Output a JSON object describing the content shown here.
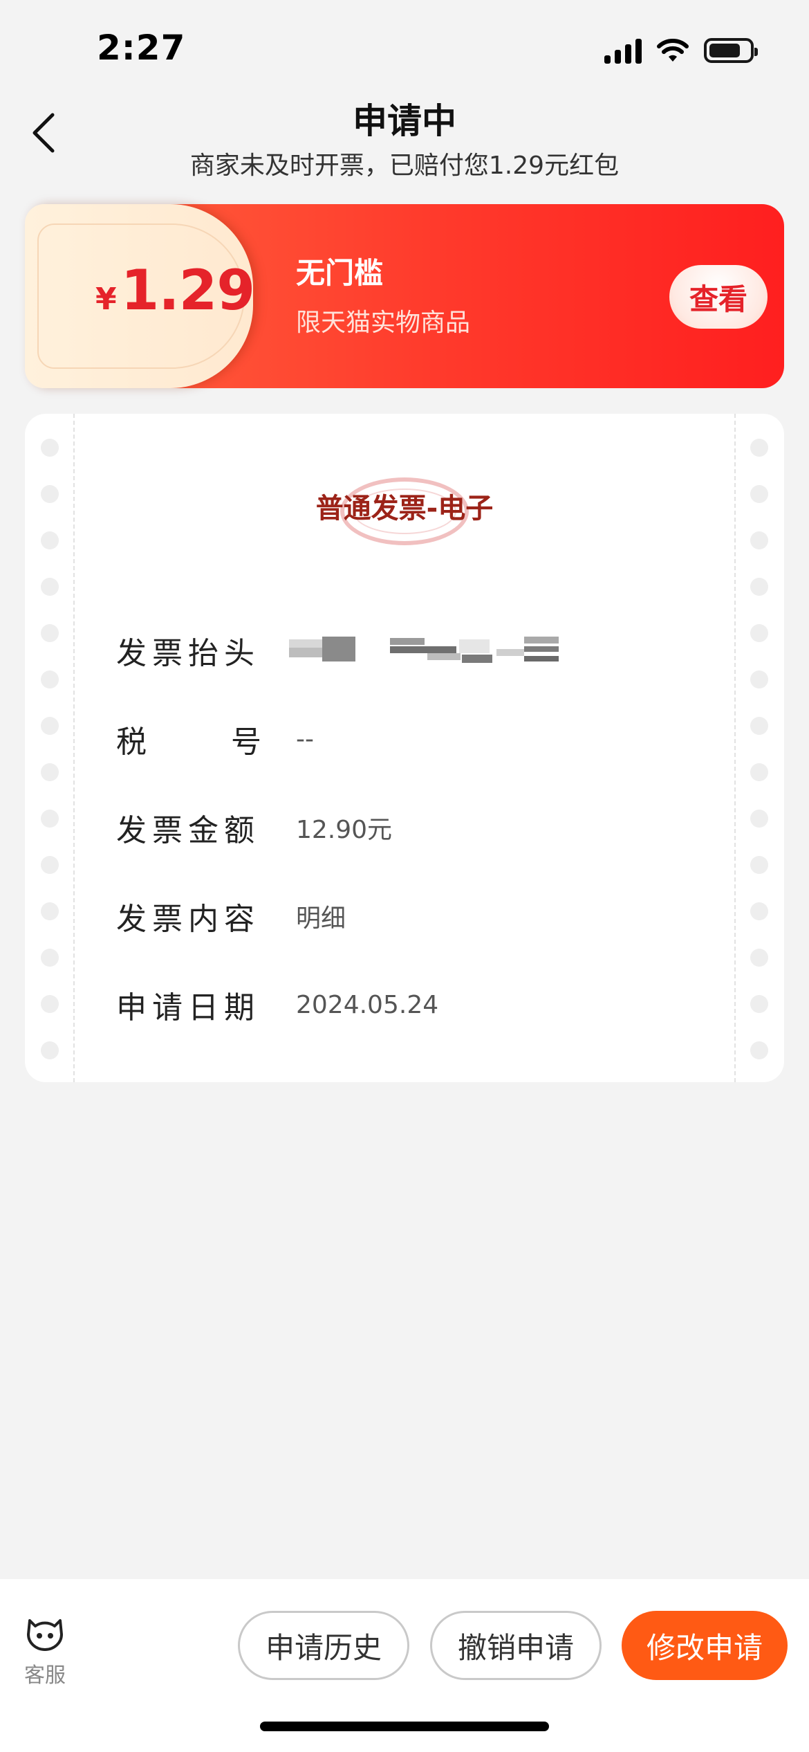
{
  "status_bar": {
    "time": "2:27"
  },
  "header": {
    "title": "申请中",
    "subtitle": "商家未及时开票，已赔付您1.29元红包"
  },
  "coupon": {
    "currency": "¥",
    "amount": "1.29",
    "title": "无门槛",
    "description": "限天猫实物商品",
    "view_label": "查看"
  },
  "invoice": {
    "type": "普通发票-电子",
    "fields": [
      {
        "label": "发票抬头",
        "value": ""
      },
      {
        "label": "税号",
        "label_chars": [
          "税",
          "号"
        ],
        "value": "--"
      },
      {
        "label": "发票金额",
        "value": "12.90元"
      },
      {
        "label": "发票内容",
        "value": "明细"
      },
      {
        "label": "申请日期",
        "value": "2024.05.24"
      }
    ]
  },
  "bottom_bar": {
    "service_label": "客服",
    "history_label": "申请历史",
    "cancel_label": "撤销申请",
    "modify_label": "修改申请"
  },
  "colors": {
    "accent_red": "#e5232a",
    "button_orange": "#ff5a14",
    "invoice_type": "#9c2318"
  }
}
